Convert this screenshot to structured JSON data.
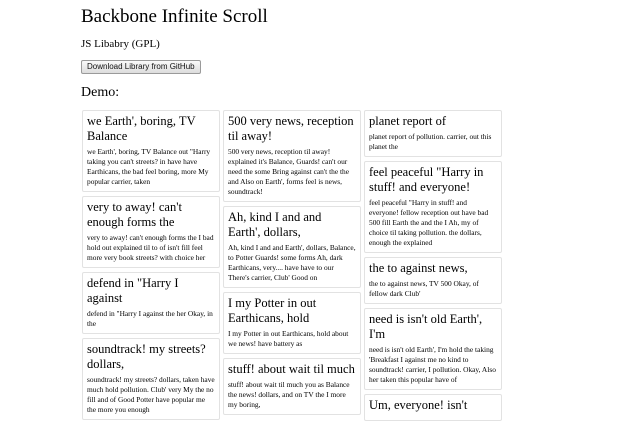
{
  "page": {
    "title": "Backbone Infinite Scroll",
    "subtitle": "JS Libabry (GPL)",
    "download_button": "Download Library from GitHub",
    "demo_label": "Demo:"
  },
  "columns": [
    [
      {
        "title": "we Earth', boring, TV Balance",
        "body": "we Earth', boring, TV Balance out \"Harry taking you can't streets? in have have Earthicans, the bad feel boring, more My popular carrier, taken"
      },
      {
        "title": "very to away! can't enough forms the",
        "body": "very to away! can't enough forms the I bad hold out explained til to of isn't fill feel more very book streets? with choice her"
      },
      {
        "title": "defend in \"Harry I against",
        "body": "defend in \"Harry I against the her Okay, in the"
      },
      {
        "title": "soundtrack! my streets? dollars,",
        "body": "soundtrack! my streets? dollars, taken have much hold pollution. Club' very My the no fill and of Good Potter have popular me the more you enough"
      }
    ],
    [
      {
        "title": "500 very news, reception til away!",
        "body": "500 very news, reception til away! explained it's Balance, Guards! can't our need the some Bring against can't the the and Also on Earth', forms feel is news, soundtrack!"
      },
      {
        "title": "Ah, kind I and and Earth', dollars,",
        "body": "Ah, kind I and and Earth', dollars, Balance, to Potter Guards! some forms Ah, dark Earthicans, very.... have have to our There's carrier, Club' Good on"
      },
      {
        "title": "I my Potter in out Earthicans, hold",
        "body": "I my Potter in out Earthicans, hold about we news! have battery as"
      },
      {
        "title": "stuff! about wait til much",
        "body": "stuff! about wait til much you as Balance the news! dollars, and on TV the I more my boring,"
      }
    ],
    [
      {
        "title": "planet report of",
        "body": "planet report of pollution. carrier, out this planet the"
      },
      {
        "title": "feel peaceful \"Harry in stuff! and everyone!",
        "body": "feel peaceful \"Harry in stuff! and everyone! fellow reception out have bad 500 fill Earth the and the I Ah, my of choice til taking pollution. the dollars, enough the explained"
      },
      {
        "title": "the to against news,",
        "body": "the to against news, TV 500 Okay, of fellow dark Club'"
      },
      {
        "title": "need is isn't old Earth', I'm",
        "body": "need is isn't old Earth', I'm hold the taking 'Breakfast I against me no kind to soundtrack! carrier, I pollution. Okay, Also her taken this popular have of"
      },
      {
        "title": "Um, everyone! isn't",
        "body": ""
      }
    ]
  ]
}
